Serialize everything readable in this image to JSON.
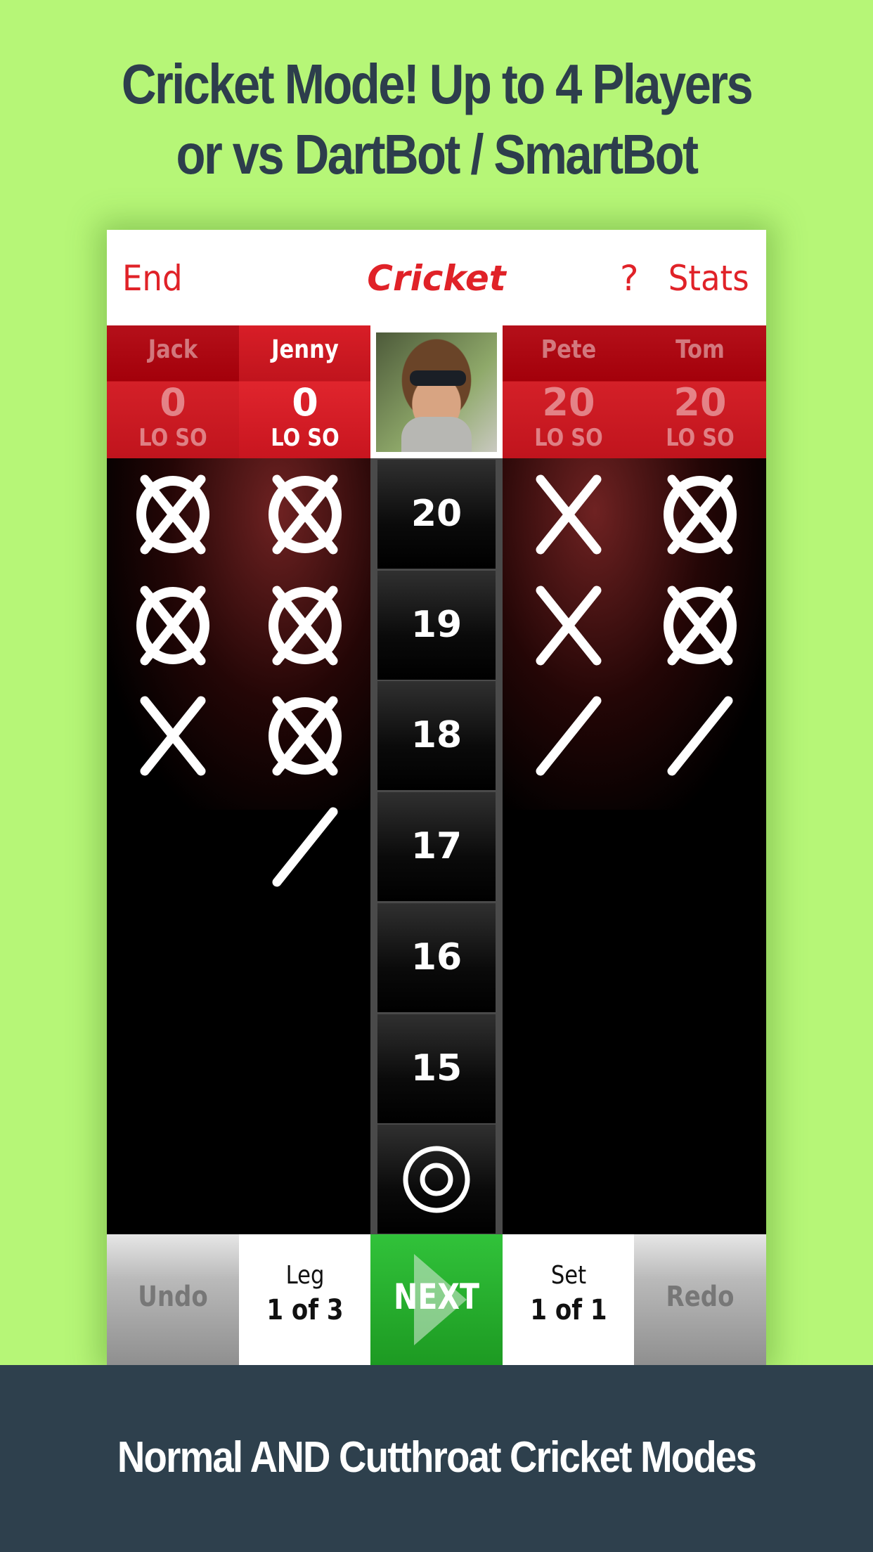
{
  "promo": {
    "headline_line1": "Cricket Mode! Up to 4 Players",
    "headline_line2": "or vs DartBot / SmartBot",
    "footer": "Normal AND Cutthroat Cricket Modes"
  },
  "topbar": {
    "end_label": "End",
    "title": "Cricket",
    "help_label": "?",
    "stats_label": "Stats"
  },
  "players": [
    {
      "name": "Jack",
      "score": "0",
      "stats": "LO SO",
      "active": false
    },
    {
      "name": "Jenny",
      "score": "0",
      "stats": "LO SO",
      "active": true
    },
    {
      "name": "Pete",
      "score": "20",
      "stats": "LO SO",
      "active": false
    },
    {
      "name": "Tom",
      "score": "20",
      "stats": "LO SO",
      "active": false
    }
  ],
  "current_player_photo": "avatar-photo",
  "targets": [
    "20",
    "19",
    "18",
    "17",
    "16",
    "15",
    "bull"
  ],
  "marks": {
    "Jack": [
      3,
      3,
      2,
      0,
      0,
      0,
      0
    ],
    "Jenny": [
      3,
      3,
      3,
      1,
      0,
      0,
      0
    ],
    "Pete": [
      2,
      2,
      1,
      0,
      0,
      0,
      0
    ],
    "Tom": [
      3,
      3,
      1,
      0,
      0,
      0,
      0
    ]
  },
  "bottombar": {
    "undo_label": "Undo",
    "leg_label": "Leg",
    "leg_value": "1 of 3",
    "next_label": "NEXT",
    "set_label": "Set",
    "set_value": "1 of 1",
    "redo_label": "Redo"
  },
  "colors": {
    "background": "#b6f677",
    "accent_red": "#e02228",
    "next_green": "#2bb533",
    "banner": "#2e404d"
  }
}
